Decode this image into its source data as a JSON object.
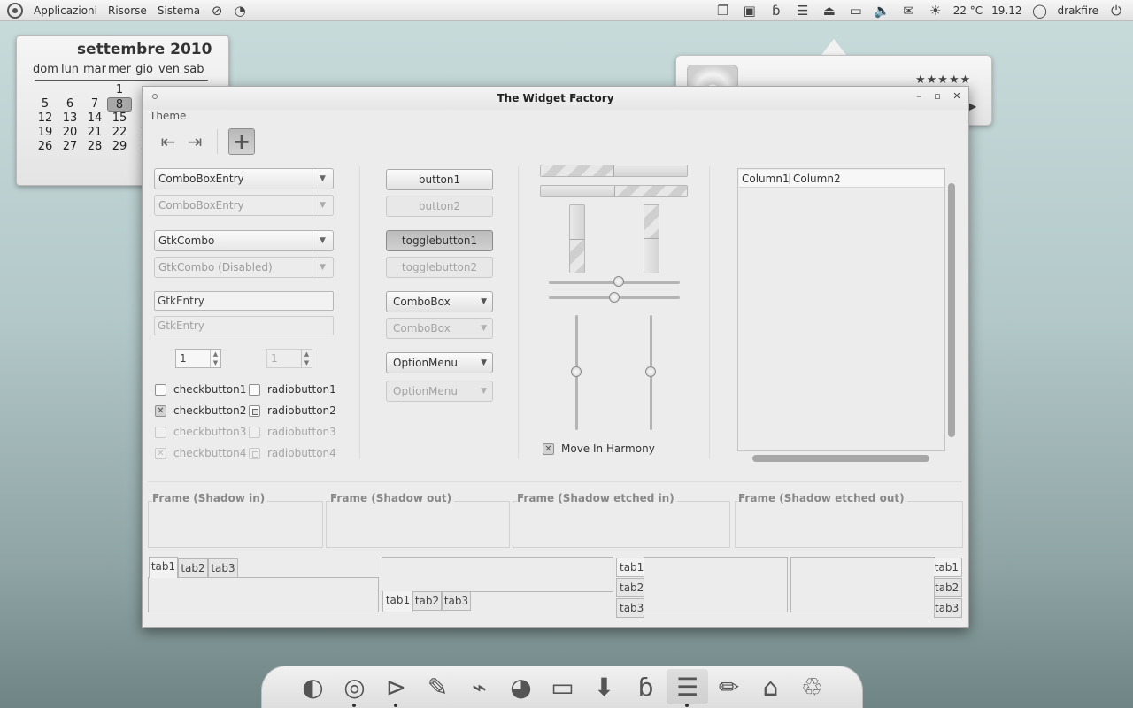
{
  "panel": {
    "menus": [
      "Applicazioni",
      "Risorse",
      "Sistema"
    ],
    "weather": "22 °C",
    "time": "19.12",
    "user": "drakfire"
  },
  "calendar": {
    "title": "settembre 2010",
    "weekdays": [
      "dom",
      "lun",
      "mar",
      "mer",
      "gio",
      "ven",
      "sab"
    ],
    "rows": [
      [
        "",
        "",
        "",
        "1",
        "",
        "",
        ""
      ],
      [
        "5",
        "6",
        "7",
        "8",
        "",
        "",
        ""
      ],
      [
        "12",
        "13",
        "14",
        "15",
        "1",
        "",
        ""
      ],
      [
        "19",
        "20",
        "21",
        "22",
        "2",
        "",
        ""
      ],
      [
        "26",
        "27",
        "28",
        "29",
        "3",
        "",
        ""
      ]
    ],
    "today": "8"
  },
  "music": {
    "rating": "★★★★★"
  },
  "window": {
    "title": "The Widget Factory",
    "menu": "Theme",
    "left": {
      "combobox_entry": "ComboBoxEntry",
      "combobox_entry_disabled": "ComboBoxEntry",
      "gtkcombo": "GtkCombo",
      "gtkcombo_disabled": "GtkCombo (Disabled)",
      "entry": "GtkEntry",
      "entry_disabled": "GtkEntry",
      "spin": "1",
      "spin_disabled": "1",
      "checks": [
        {
          "label": "checkbutton1",
          "checked": false,
          "disabled": false
        },
        {
          "label": "checkbutton2",
          "checked": true,
          "disabled": false
        },
        {
          "label": "checkbutton3",
          "checked": false,
          "disabled": true
        },
        {
          "label": "checkbutton4",
          "checked": true,
          "disabled": true
        }
      ],
      "radios": [
        {
          "label": "radiobutton1",
          "checked": false,
          "disabled": false
        },
        {
          "label": "radiobutton2",
          "checked": true,
          "disabled": false
        },
        {
          "label": "radiobutton3",
          "checked": false,
          "disabled": true
        },
        {
          "label": "radiobutton4",
          "checked": true,
          "disabled": true
        }
      ]
    },
    "middle": {
      "button1": "button1",
      "button2": "button2",
      "toggle1": "togglebutton1",
      "toggle2": "togglebutton2",
      "combobox": "ComboBox",
      "combobox_disabled": "ComboBox",
      "optionmenu": "OptionMenu",
      "optionmenu_disabled": "OptionMenu"
    },
    "harmony": "Move In Harmony",
    "tree": {
      "columns": [
        "Column1",
        "Column2"
      ]
    },
    "frames": [
      "Frame (Shadow in)",
      "Frame (Shadow out)",
      "Frame (Shadow etched in)",
      "Frame (Shadow etched out)"
    ],
    "tabs": [
      "tab1",
      "tab2",
      "tab3"
    ]
  }
}
